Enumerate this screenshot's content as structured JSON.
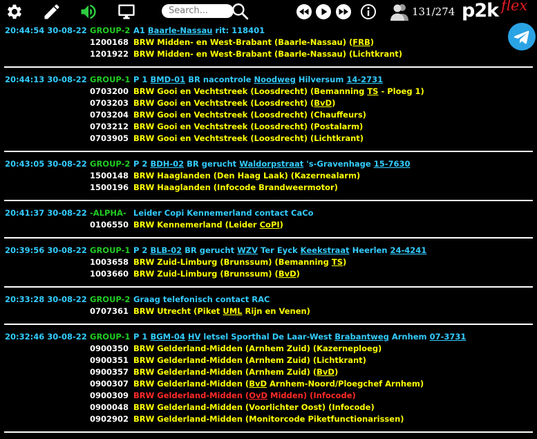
{
  "toolbar": {
    "search": {
      "placeholder": "Search..."
    },
    "counter": "131/274",
    "logo": {
      "main": "p2k",
      "accent": "flex"
    },
    "icons": [
      "gear-icon",
      "pencil-icon",
      "speaker-icon",
      "monitor-icon",
      "search-icon",
      "rewind-icon",
      "play-icon",
      "fast-forward-icon",
      "info-icon",
      "users-icon",
      "telegram-icon"
    ],
    "colors": {
      "speaker": "#2ecc40",
      "telegram": "#2aa3e5",
      "logo_accent": "#e31b23"
    }
  },
  "colors": {
    "time": "#33ccff",
    "group": "#22cc22",
    "capcode": "#ffffff",
    "text": "#ffff00",
    "alert": "#ff2a2a"
  },
  "messages": [
    {
      "time": "20:44:54 30-08-22",
      "group": "GROUP-2",
      "main": [
        "A1 ",
        "Baarle-Nassau",
        " rit: 118401"
      ],
      "rows": [
        {
          "cap": "1200168",
          "parts": [
            "BRW Midden- en West-Brabant (Baarle-Nassau) (",
            "FRB",
            ")"
          ]
        },
        {
          "cap": "1201922",
          "parts": [
            "BRW Midden- en West-Brabant (Baarle-Nassau) (Lichtkrant)"
          ]
        }
      ]
    },
    {
      "time": "20:44:13 30-08-22",
      "group": "GROUP-1",
      "main": [
        "P 1 ",
        "BMD-01",
        " BR nacontrole ",
        "Noodweg",
        " Hilversum ",
        "14-2731"
      ],
      "rows": [
        {
          "cap": "0703200",
          "parts": [
            "BRW Gooi en Vechtstreek (Loosdrecht) (Bemanning ",
            "TS",
            " - Ploeg 1)"
          ]
        },
        {
          "cap": "0703203",
          "parts": [
            "BRW Gooi en Vechtstreek (Loosdrecht) (",
            "BvD",
            ")"
          ]
        },
        {
          "cap": "0703204",
          "parts": [
            "BRW Gooi en Vechtstreek (Loosdrecht) (Chauffeurs)"
          ]
        },
        {
          "cap": "0703212",
          "parts": [
            "BRW Gooi en Vechtstreek (Loosdrecht) (Postalarm)"
          ]
        },
        {
          "cap": "0703905",
          "parts": [
            "BRW Gooi en Vechtstreek (Loosdrecht) (Lichtkrant)"
          ]
        }
      ]
    },
    {
      "time": "20:43:05 30-08-22",
      "group": "GROUP-2",
      "main": [
        "P 2 ",
        "BDH-02",
        " BR gerucht ",
        "Waldorpstraat",
        " 's-Gravenhage ",
        "15-7630"
      ],
      "rows": [
        {
          "cap": "1500148",
          "parts": [
            "BRW Haaglanden (Den Haag Laak) (Kazernealarm)"
          ]
        },
        {
          "cap": "1500196",
          "parts": [
            "BRW Haaglanden (Infocode Brandweermotor)"
          ]
        }
      ]
    },
    {
      "time": "20:41:37 30-08-22",
      "group": "-ALPHA-",
      "main": [
        "Leider Copi Kennemerland contact CaCo"
      ],
      "rows": [
        {
          "cap": "0106550",
          "parts": [
            "BRW Kennemerland (Leider ",
            "CoPI",
            ")"
          ]
        }
      ]
    },
    {
      "time": "20:39:56 30-08-22",
      "group": "GROUP-1",
      "main": [
        "P 2 ",
        "BLB-02",
        " BR gerucht ",
        "WZV",
        " Ter Eyck ",
        "Keekstraat",
        " Heerlen ",
        "24-4241"
      ],
      "rows": [
        {
          "cap": "1003658",
          "parts": [
            "BRW Zuid-Limburg (Brunssum) (Bemanning ",
            "TS",
            ")"
          ]
        },
        {
          "cap": "1003660",
          "parts": [
            "BRW Zuid-Limburg (Brunssum) (",
            "BvD",
            ")"
          ]
        }
      ]
    },
    {
      "time": "20:33:28 30-08-22",
      "group": "GROUP-2",
      "main": [
        "Graag telefonisch contact RAC"
      ],
      "rows": [
        {
          "cap": "0707361",
          "parts": [
            "BRW Utrecht (Piket ",
            "UML",
            " Rijn en Venen)"
          ]
        }
      ]
    },
    {
      "time": "20:32:46 30-08-22",
      "group": "GROUP-1",
      "main": [
        "P 1 ",
        "BGM-04",
        " ",
        "HV",
        " letsel Sporthal De Laar-West ",
        "Brabantweg",
        " Arnhem ",
        "07-3731"
      ],
      "rows": [
        {
          "cap": "0900350",
          "parts": [
            "BRW Gelderland-Midden (Arnhem Zuid) (Kazerneploeg)"
          ]
        },
        {
          "cap": "0900351",
          "parts": [
            "BRW Gelderland-Midden (Arnhem Zuid) (Lichtkrant)"
          ]
        },
        {
          "cap": "0900357",
          "parts": [
            "BRW Gelderland-Midden (Arnhem Zuid) (",
            "BvD",
            ")"
          ]
        },
        {
          "cap": "0900307",
          "parts": [
            "BRW Gelderland-Midden (",
            "BvD",
            " Arnhem-Noord/Ploegchef Arnhem)"
          ]
        },
        {
          "cap": "0900309",
          "parts": [
            "BRW Gelderland-Midden (",
            "OvD",
            " Midden) (Infocode)"
          ],
          "alert": true
        },
        {
          "cap": "0900048",
          "parts": [
            "BRW Gelderland-Midden (Voorlichter Oost) (Infocode)"
          ]
        },
        {
          "cap": "0902902",
          "parts": [
            "BRW Gelderland-Midden (Monitorcode Piketfunctionarissen)"
          ]
        }
      ]
    }
  ]
}
